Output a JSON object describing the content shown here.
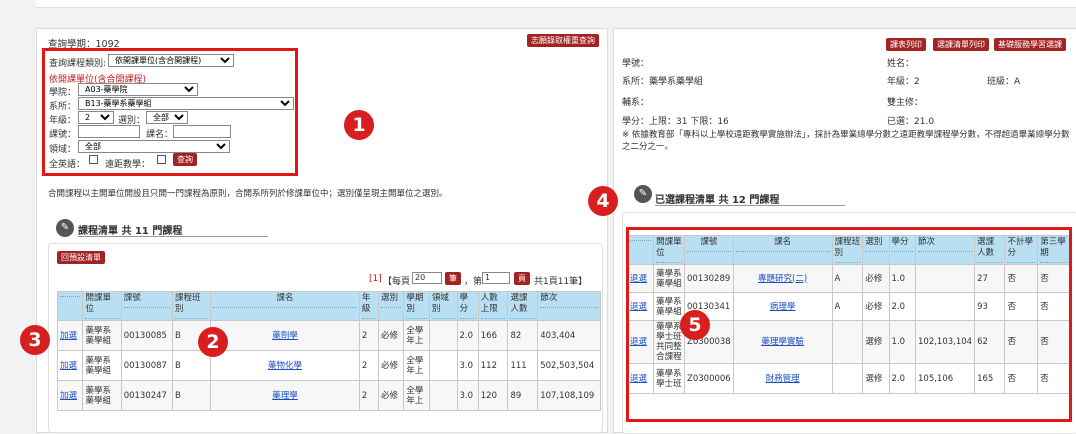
{
  "left": {
    "semester": "查詢學期：1092",
    "volunteer_query_btn": "志願錄取權重查詢",
    "course_type_label": "查詢課程類別:",
    "course_type_value": "依開課單位(含合開課程)",
    "unit_heading": "依開課單位(含合開課程)",
    "college_label": "學院：",
    "college_value": "A03-藥學院",
    "dept_label": "系所：",
    "dept_value": "B13-藥學系藥學組",
    "grade_label": "年級：",
    "grade_value": "2",
    "elective_label": "選別：",
    "elective_value": "全部",
    "course_no_label": "課號：",
    "course_name_label": "課名：",
    "field_label": "領域：",
    "field_value": "全部",
    "english_label": "全英語：",
    "distance_label": "遠距教學：",
    "query_btn": "查詢",
    "note": "合開課程以主開單位開設且只開一門課程為原則，合開系所列於修課單位中；選別僅呈現主開單位之選別。",
    "list_title": "課程清單 共 11 門課程",
    "back_btn": "回預設清單",
    "pager": {
      "first": "[1]",
      "per_page_pre": "【每頁",
      "per_page": "20",
      "per_page_btn": "筆",
      "page_pre": "，第",
      "page": "1",
      "page_btn": "頁",
      "page_post": "共1頁11筆】"
    },
    "table": {
      "headers": [
        "",
        "開課單位",
        "課號",
        "課程班別",
        "課名",
        "年級",
        "選別",
        "學期別",
        "領域別",
        "學分",
        "人數上限",
        "選課人數",
        "節次"
      ],
      "rows": [
        [
          "加選",
          "藥學系藥學組",
          "00130085",
          "B",
          "藥劑學",
          "2",
          "必修",
          "全學年上",
          "",
          "2.0",
          "166",
          "82",
          "403,404"
        ],
        [
          "加選",
          "藥學系藥學組",
          "00130087",
          "B",
          "藥物化學",
          "2",
          "必修",
          "全學年上",
          "",
          "3.0",
          "112",
          "111",
          "502,503,504"
        ],
        [
          "加選",
          "藥學系藥學組",
          "00130247",
          "B",
          "藥理學",
          "2",
          "必修",
          "全學年上",
          "",
          "3.0",
          "120",
          "89",
          "107,108,109"
        ]
      ]
    }
  },
  "right": {
    "print_btn": "課表列印",
    "selected_print_btn": "選課清單列印",
    "basic_btn": "基礎服務學習選課",
    "student_no": "學號：",
    "name": "姓名：",
    "dept": "系所：藥學系藥學組",
    "grade": "年級：2",
    "class": "班級：A",
    "minor": "輔系：",
    "double": "雙主修：",
    "credits": "學分：上限：31 下限：16",
    "selected_credits": "已選：21.0",
    "notice": "※ 依據教育部「專科以上學校遠距教學實施辦法」，採計為畢業總學分數之遠距教學課程學分數，不得超過畢業總學分數之二分之一。",
    "list_title": "已選課程清單 共 12 門課程",
    "table": {
      "headers": [
        "",
        "開課單位",
        "課號",
        "課名",
        "課程班別",
        "選別",
        "學分",
        "節次",
        "選課人數",
        "不計學分",
        "第三學期"
      ],
      "rows": [
        [
          "退選",
          "藥學系藥學組",
          "00130289",
          "專題研究(二)",
          "A",
          "必修",
          "1.0",
          "",
          "27",
          "否",
          "否"
        ],
        [
          "退選",
          "藥學系藥學組",
          "00130341",
          "病理學",
          "A",
          "必修",
          "2.0",
          "",
          "93",
          "否",
          "否"
        ],
        [
          "退選",
          "藥學系學士班共同整合課程",
          "Z0300038",
          "藥理學實驗",
          "",
          "選修",
          "1.0",
          "102,103,104",
          "62",
          "否",
          "否"
        ],
        [
          "退選",
          "藥學系學士班",
          "Z0300006",
          "財務管理",
          "",
          "選修",
          "2.0",
          "105,106",
          "165",
          "否",
          "否"
        ]
      ]
    }
  },
  "markers": [
    "1",
    "2",
    "3",
    "4",
    "5"
  ],
  "colors": {
    "accent_red": "#a32323",
    "highlight_red": "#e01818",
    "header_blue": "#b9dff2",
    "link_blue": "#1d4fc4"
  }
}
